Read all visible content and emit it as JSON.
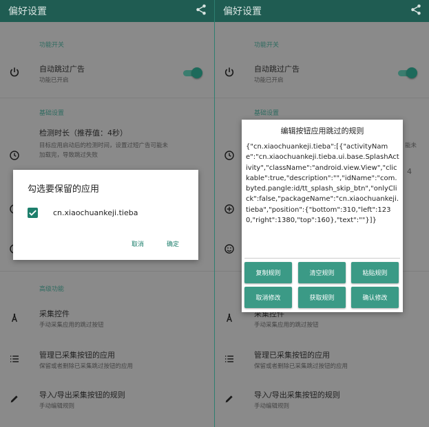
{
  "app": {
    "title": "偏好设置"
  },
  "sections": {
    "switches": "功能开关",
    "basic": "基础设置",
    "advanced": "高级功能"
  },
  "rows": {
    "auto_skip": {
      "title": "自动跳过广告",
      "subtitle": "功能已开启"
    },
    "detect": {
      "title": "检测时长（推荐值：4秒）",
      "subtitle_left": "目标应用启动后的检测时间，设置过短广告可能未",
      "subtitle_left_2": "加载完，导致跳过失败",
      "subtitle_right_fragment": "能未",
      "value_fragment": "4"
    },
    "collect": {
      "title": "采集控件",
      "subtitle": "手动采集应用的跳过按钮"
    },
    "manage": {
      "title": "管理已采集按钮的应用",
      "subtitle": "保留或者删除已采集跳过按钮的应用"
    },
    "import": {
      "title": "导入/导出采集按钮的规则",
      "subtitle": "手动编辑规则"
    }
  },
  "dialog_keep": {
    "title": "勾选要保留的应用",
    "app_label": "cn.xiaochuankeji.tieba",
    "cancel": "取消",
    "ok": "确定"
  },
  "dialog_rules": {
    "title": "编辑按钮应用跳过的规则",
    "json_text": "{\"cn.xiaochuankeji.tieba\":[{\"activityName\":\"cn.xiaochuankeji.tieba.ui.base.SplashActivity\",\"className\":\"android.view.View\",\"clickable\":true,\"description\":\"\",\"idName\":\"com.byted.pangle:id/tt_splash_skip_btn\",\"onlyClick\":false,\"packageName\":\"cn.xiaochuankeji.tieba\",\"position\":{\"bottom\":310,\"left\":1230,\"right\":1380,\"top\":160},\"text\":\"\"}]}",
    "buttons": {
      "copy": "复制规则",
      "clear": "清空规则",
      "paste": "粘贴规则",
      "cancel": "取消修改",
      "fetch": "获取规则",
      "confirm": "确认修改"
    }
  },
  "colors": {
    "accent": "#1d7f6c",
    "appbar": "#1f5c52",
    "button": "#3b9a86"
  }
}
